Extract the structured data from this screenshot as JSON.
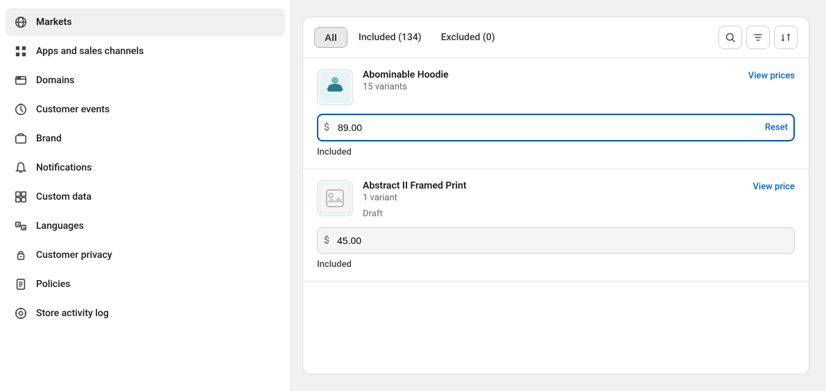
{
  "sidebar": {
    "items": [
      {
        "id": "markets",
        "label": "Markets",
        "active": true,
        "icon": "globe-icon"
      },
      {
        "id": "apps-sales",
        "label": "Apps and sales channels",
        "active": false,
        "icon": "apps-icon"
      },
      {
        "id": "domains",
        "label": "Domains",
        "active": false,
        "icon": "domains-icon"
      },
      {
        "id": "customer-events",
        "label": "Customer events",
        "active": false,
        "icon": "events-icon"
      },
      {
        "id": "brand",
        "label": "Brand",
        "active": false,
        "icon": "brand-icon"
      },
      {
        "id": "notifications",
        "label": "Notifications",
        "active": false,
        "icon": "bell-icon"
      },
      {
        "id": "custom-data",
        "label": "Custom data",
        "active": false,
        "icon": "data-icon"
      },
      {
        "id": "languages",
        "label": "Languages",
        "active": false,
        "icon": "languages-icon"
      },
      {
        "id": "customer-privacy",
        "label": "Customer privacy",
        "active": false,
        "icon": "privacy-icon"
      },
      {
        "id": "policies",
        "label": "Policies",
        "active": false,
        "icon": "policies-icon"
      },
      {
        "id": "store-activity-log",
        "label": "Store activity log",
        "active": false,
        "icon": "log-icon"
      }
    ]
  },
  "tabs": {
    "all_label": "All",
    "included_label": "Included (134)",
    "excluded_label": "Excluded (0)"
  },
  "products": [
    {
      "id": "abominable-hoodie",
      "name": "Abominable Hoodie",
      "variants": "15 variants",
      "view_link": "View prices",
      "price": "89.00",
      "price_prefix": "$",
      "reset_label": "Reset",
      "status": "Included",
      "active_input": true,
      "has_image": true
    },
    {
      "id": "abstract-ii-framed-print",
      "name": "Abstract II Framed Print",
      "variants": "1 variant",
      "view_link": "View price",
      "price": "45.00",
      "price_prefix": "$",
      "reset_label": "",
      "status": "Included",
      "product_status": "Draft",
      "active_input": false,
      "has_image": false
    }
  ],
  "icons": {
    "search": "🔍",
    "filter": "☰",
    "sort": "⇅"
  }
}
